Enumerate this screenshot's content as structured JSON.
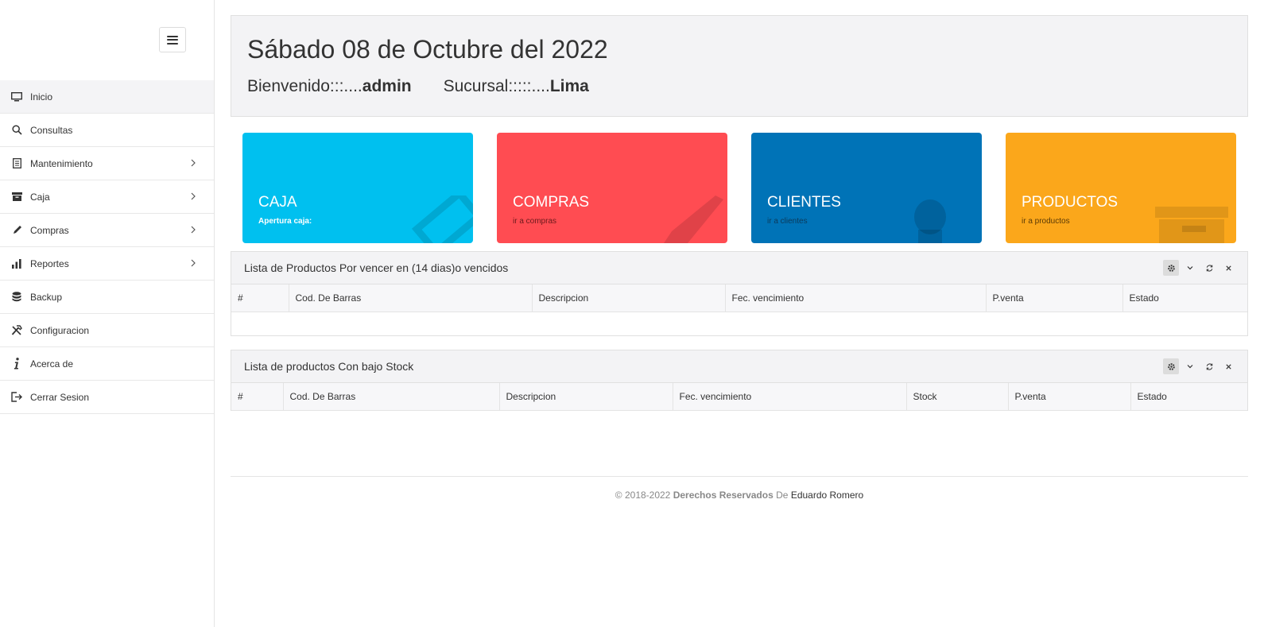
{
  "sidebar": {
    "items": [
      {
        "label": "Inicio",
        "icon": "monitor-icon",
        "has_submenu": false,
        "active": true
      },
      {
        "label": "Consultas",
        "icon": "search-icon",
        "has_submenu": false
      },
      {
        "label": "Mantenimiento",
        "icon": "document-icon",
        "has_submenu": true
      },
      {
        "label": "Caja",
        "icon": "cash-box-icon",
        "has_submenu": true
      },
      {
        "label": "Compras",
        "icon": "pencil-icon",
        "has_submenu": true
      },
      {
        "label": "Reportes",
        "icon": "bar-chart-icon",
        "has_submenu": true
      },
      {
        "label": "Backup",
        "icon": "database-icon",
        "has_submenu": false
      },
      {
        "label": "Configuracion",
        "icon": "tools-icon",
        "has_submenu": false
      },
      {
        "label": "Acerca de",
        "icon": "info-icon",
        "has_submenu": false
      },
      {
        "label": "Cerrar Sesion",
        "icon": "logout-icon",
        "has_submenu": false
      }
    ]
  },
  "header": {
    "date": "Sábado 08 de Octubre del 2022",
    "welcome_label": "Bienvenido:::....",
    "user": "admin",
    "branch_label": "Sucursal:::::....",
    "branch": "Lima"
  },
  "tiles": [
    {
      "title": "CAJA",
      "subtitle": "Apertura caja:",
      "color": "#00c0ef",
      "icon": "ticket-icon"
    },
    {
      "title": "COMPRAS",
      "subtitle": "ir a compras",
      "color": "#ff4c52",
      "icon": "pencil-icon"
    },
    {
      "title": "CLIENTES",
      "subtitle": "ir a clientes",
      "color": "#0073b7",
      "icon": "user-icon"
    },
    {
      "title": "PRODUCTOS",
      "subtitle": "ir a productos",
      "color": "#fba71b",
      "icon": "archive-icon"
    }
  ],
  "panel_expiring": {
    "title": "Lista de Productos Por vencer en (14 dias)o vencidos",
    "columns": [
      "#",
      "Cod. De Barras",
      "Descripcion",
      "Fec. vencimiento",
      "P.venta",
      "Estado"
    ],
    "rows": []
  },
  "panel_low_stock": {
    "title": "Lista de productos Con bajo Stock",
    "columns": [
      "#",
      "Cod. De Barras",
      "Descripcion",
      "Fec. vencimiento",
      "Stock",
      "P.venta",
      "Estado"
    ],
    "rows": []
  },
  "footer": {
    "copyright": "© 2018-2022",
    "rights": "Derechos Reservados",
    "by": "De",
    "author": "Eduardo Romero"
  }
}
